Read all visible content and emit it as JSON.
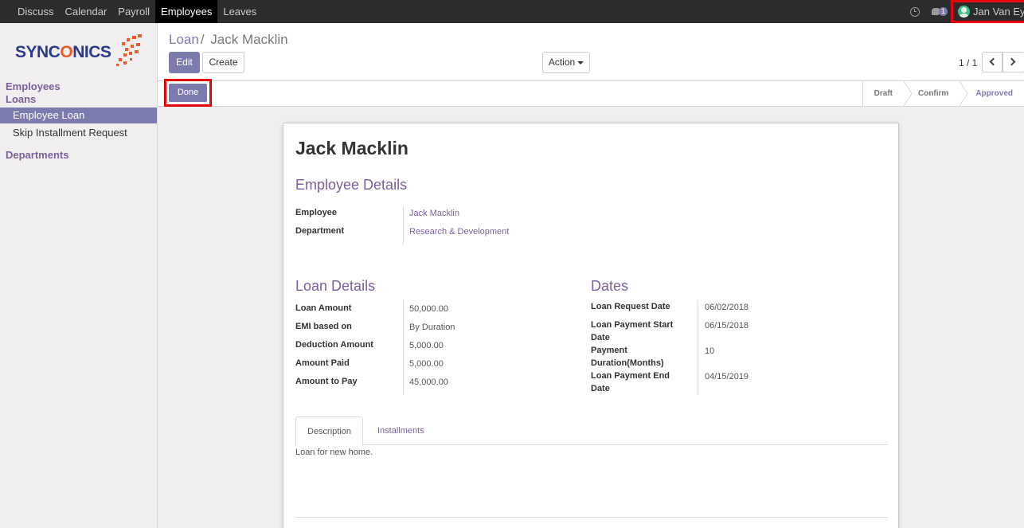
{
  "topbar": {
    "menu": [
      "Discuss",
      "Calendar",
      "Payroll",
      "Employees",
      "Leaves"
    ],
    "active_menu": "Employees",
    "chat_count": "1",
    "user": "Jan Van Eyck"
  },
  "sidebar": {
    "logo": "SYNCONICS",
    "sections": {
      "employees": "Employees",
      "loans": "Loans",
      "departments": "Departments"
    },
    "items": [
      "Employee Loan",
      "Skip Installment Request"
    ]
  },
  "control_panel": {
    "breadcrumb_parent": "Loan",
    "breadcrumb_current": "Jack Macklin",
    "edit": "Edit",
    "create": "Create",
    "action": "Action",
    "pager": "1 / 1"
  },
  "statusbar": {
    "done": "Done",
    "stages": [
      "Draft",
      "Confirm",
      "Approved"
    ],
    "current_stage": "Approved"
  },
  "form": {
    "title": "Jack Macklin",
    "employee_details": {
      "heading": "Employee Details",
      "employee_label": "Employee",
      "employee_value": "Jack Macklin",
      "department_label": "Department",
      "department_value": "Research & Development"
    },
    "loan_details": {
      "heading": "Loan Details",
      "rows": [
        {
          "label": "Loan Amount",
          "value": "50,000.00"
        },
        {
          "label": "EMI based on",
          "value": "By Duration"
        },
        {
          "label": "Deduction Amount",
          "value": "5,000.00"
        },
        {
          "label": "Amount Paid",
          "value": "5,000.00"
        },
        {
          "label": "Amount to Pay",
          "value": "45,000.00"
        }
      ]
    },
    "dates": {
      "heading": "Dates",
      "rows": [
        {
          "label": "Loan Request Date",
          "value": "06/02/2018"
        },
        {
          "label": "Loan Payment Start Date",
          "value": "06/15/2018"
        },
        {
          "label": "Payment Duration(Months)",
          "value": "10"
        },
        {
          "label": "Loan Payment End Date",
          "value": "04/15/2019"
        }
      ]
    },
    "tabs": [
      "Description",
      "Installments"
    ],
    "active_tab": "Description",
    "description": "Loan for new home."
  },
  "colors": {
    "accent": "#7c7bad",
    "heading": "#7c5f9e",
    "highlight": "#e8000b",
    "topbar": "#2c2c2c"
  }
}
